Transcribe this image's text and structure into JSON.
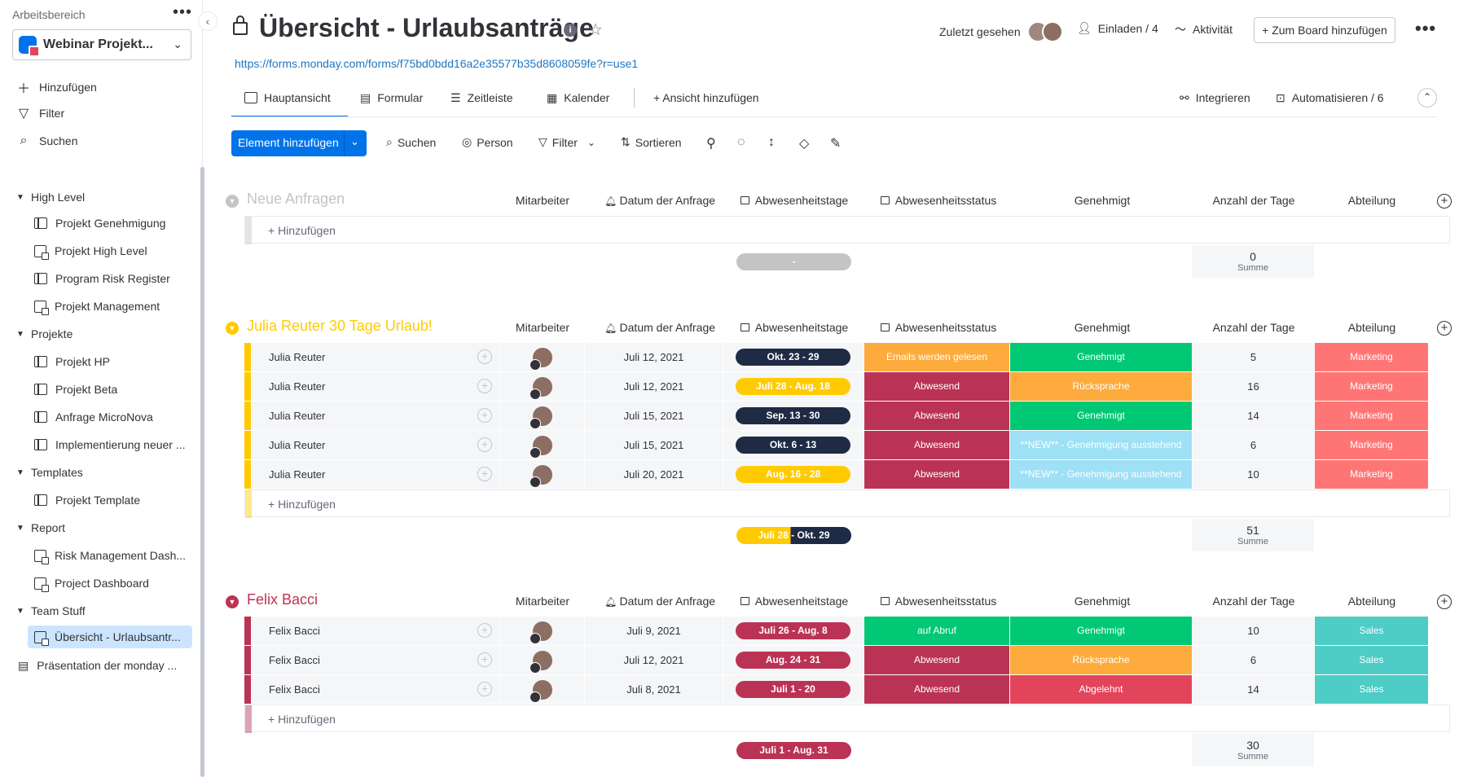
{
  "sidebar": {
    "workspace_label": "Arbeitsbereich",
    "workspace_name": "Webinar Projekt...",
    "actions": [
      "Hinzufügen",
      "Filter",
      "Suchen"
    ],
    "folders": [
      {
        "name": "High Level",
        "boards": [
          "Projekt Genehmigung",
          "Projekt High Level",
          "Program Risk Register",
          "Projekt Management"
        ]
      },
      {
        "name": "Projekte",
        "boards": [
          "Projekt HP",
          "Projekt Beta",
          "Anfrage MicroNova",
          "Implementierung neuer ..."
        ]
      },
      {
        "name": "Templates",
        "boards": [
          "Projekt Template"
        ]
      },
      {
        "name": "Report",
        "boards": [
          "Risk Management Dash...",
          "Project Dashboard"
        ]
      },
      {
        "name": "Team Stuff",
        "boards": [
          "Übersicht - Urlaubsantr..."
        ]
      }
    ],
    "doc_item": "Präsentation der monday ..."
  },
  "header": {
    "title": "Übersicht - Urlaubsanträge",
    "url": "https://forms.monday.com/forms/f75bd0bdd16a2e35577b35d8608059fe?r=use1",
    "zuletzt": "Zuletzt gesehen",
    "einladen": "Einladen / 4",
    "aktivitaet": "Aktivität",
    "board_btn": "+ Zum Board hinzufügen"
  },
  "tabs": {
    "main": "Hauptansicht",
    "form": "Formular",
    "timeline": "Zeitleiste",
    "calendar": "Kalender",
    "add_view": "+ Ansicht hinzufügen",
    "integrate": "Integrieren",
    "automate": "Automatisieren / 6"
  },
  "toolbar": {
    "add_item": "Element hinzufügen",
    "search": "Suchen",
    "person": "Person",
    "filter": "Filter",
    "sort": "Sortieren"
  },
  "columns": {
    "employee": "Mitarbeiter",
    "date": "Datum der Anfrage",
    "days": "Abwesenheitstage",
    "status": "Abwesenheitsstatus",
    "approved": "Genehmigt",
    "count": "Anzahl der Tage",
    "department": "Abteilung"
  },
  "add_row_label": "+ Hinzufügen",
  "sum_label": "Summe",
  "colors": {
    "accent": "#0073ea",
    "navy": "#1f2a44",
    "yellow": "#ffcb00",
    "crimson": "#bb3354",
    "orange": "#fdab3d",
    "green": "#00c875",
    "red": "#e2445c",
    "lightblue": "#9ee0f5",
    "salmon": "#ff7575",
    "teal": "#4eccc6",
    "grey": "#c4c4c4"
  },
  "groups": [
    {
      "title": "Neue Anfragen",
      "color": "#c4c4c4",
      "rows": [],
      "summary": {
        "timeline": "-",
        "sum": "0"
      }
    },
    {
      "title": "Julia Reuter 30 Tage Urlaub!",
      "color": "#ffcb00",
      "rows": [
        {
          "name": "Julia Reuter",
          "date": "Juli 12, 2021",
          "days": "Okt. 23 - 29",
          "days_color": "#1f2a44",
          "status": "Emails werden gelesen",
          "status_color": "#fdab3d",
          "approved": "Genehmigt",
          "approved_color": "#00c875",
          "count": "5",
          "dept": "Marketing",
          "dept_color": "#ff7575"
        },
        {
          "name": "Julia Reuter",
          "date": "Juli 12, 2021",
          "days": "Juli 28 - Aug. 18",
          "days_color": "#ffcb00",
          "status": "Abwesend",
          "status_color": "#bb3354",
          "approved": "Rücksprache",
          "approved_color": "#fdab3d",
          "count": "16",
          "dept": "Marketing",
          "dept_color": "#ff7575"
        },
        {
          "name": "Julia Reuter",
          "date": "Juli 15, 2021",
          "days": "Sep. 13 - 30",
          "days_color": "#1f2a44",
          "status": "Abwesend",
          "status_color": "#bb3354",
          "approved": "Genehmigt",
          "approved_color": "#00c875",
          "count": "14",
          "dept": "Marketing",
          "dept_color": "#ff7575"
        },
        {
          "name": "Julia Reuter",
          "date": "Juli 15, 2021",
          "days": "Okt. 6 - 13",
          "days_color": "#1f2a44",
          "status": "Abwesend",
          "status_color": "#bb3354",
          "approved": "**NEW** - Genehmigung ausstehend",
          "approved_color": "#9ee0f5",
          "count": "6",
          "dept": "Marketing",
          "dept_color": "#ff7575"
        },
        {
          "name": "Julia Reuter",
          "date": "Juli 20, 2021",
          "days": "Aug. 16 - 28",
          "days_color": "#ffcb00",
          "status": "Abwesend",
          "status_color": "#bb3354",
          "approved": "**NEW** - Genehmigung ausstehend",
          "approved_color": "#9ee0f5",
          "count": "10",
          "dept": "Marketing",
          "dept_color": "#ff7575"
        }
      ],
      "summary": {
        "timeline": "Juli 28 - Okt. 29",
        "sum": "51"
      }
    },
    {
      "title": "Felix Bacci",
      "color": "#bb3354",
      "rows": [
        {
          "name": "Felix Bacci",
          "date": "Juli 9, 2021",
          "days": "Juli 26 - Aug. 8",
          "days_color": "#bb3354",
          "status": "auf Abruf",
          "status_color": "#00c875",
          "approved": "Genehmigt",
          "approved_color": "#00c875",
          "count": "10",
          "dept": "Sales",
          "dept_color": "#4eccc6"
        },
        {
          "name": "Felix Bacci",
          "date": "Juli 12, 2021",
          "days": "Aug. 24 - 31",
          "days_color": "#bb3354",
          "status": "Abwesend",
          "status_color": "#bb3354",
          "approved": "Rücksprache",
          "approved_color": "#fdab3d",
          "count": "6",
          "dept": "Sales",
          "dept_color": "#4eccc6"
        },
        {
          "name": "Felix Bacci",
          "date": "Juli 8, 2021",
          "days": "Juli 1 - 20",
          "days_color": "#bb3354",
          "status": "Abwesend",
          "status_color": "#bb3354",
          "approved": "Abgelehnt",
          "approved_color": "#e2445c",
          "count": "14",
          "dept": "Sales",
          "dept_color": "#4eccc6"
        }
      ],
      "summary": {
        "timeline": "Juli 1 - Aug. 31",
        "sum": "30"
      }
    }
  ]
}
